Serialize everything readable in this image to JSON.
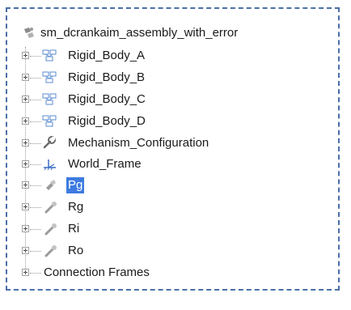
{
  "tree": {
    "root": {
      "label": "sm_dcrankaim_assembly_with_error",
      "icon": "model-assembly-icon"
    },
    "children": [
      {
        "label": "Rigid_Body_A",
        "icon": "rigid-body-icon"
      },
      {
        "label": "Rigid_Body_B",
        "icon": "rigid-body-icon"
      },
      {
        "label": "Rigid_Body_C",
        "icon": "rigid-body-icon"
      },
      {
        "label": "Rigid_Body_D",
        "icon": "rigid-body-icon"
      },
      {
        "label": "Mechanism_Configuration",
        "icon": "wrench-icon"
      },
      {
        "label": "World_Frame",
        "icon": "world-frame-icon"
      },
      {
        "label": "Pg",
        "icon": "planar-joint-icon",
        "selected": true
      },
      {
        "label": "Rg",
        "icon": "revolute-joint-icon"
      },
      {
        "label": "Ri",
        "icon": "revolute-joint-icon"
      },
      {
        "label": "Ro",
        "icon": "revolute-joint-icon"
      },
      {
        "label": "Connection Frames",
        "icon": ""
      }
    ]
  },
  "colors": {
    "selection": "#3d7be0",
    "frame_border": "#4a6fa8"
  }
}
